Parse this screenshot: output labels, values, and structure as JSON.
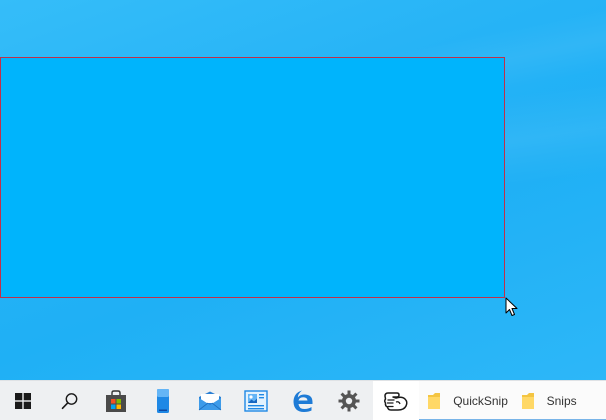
{
  "desktop": {
    "background_color": "#26b3f6",
    "selection_color": "#00b4fc",
    "selection_border_color": "#c0304a"
  },
  "taskbar": {
    "buttons": [
      {
        "icon": "windows-start-icon"
      },
      {
        "icon": "search-icon"
      },
      {
        "icon": "store-icon"
      },
      {
        "icon": "phone-icon"
      },
      {
        "icon": "mail-icon"
      },
      {
        "icon": "photos-icon"
      },
      {
        "icon": "edge-icon"
      },
      {
        "icon": "settings-gear-icon"
      },
      {
        "icon": "snip-hand-icon"
      }
    ],
    "apps": [
      {
        "label": "QuickSnip",
        "icon": "folder-icon"
      },
      {
        "label": "Snips",
        "icon": "folder-icon"
      }
    ],
    "accent_color": "#78b4e8"
  }
}
